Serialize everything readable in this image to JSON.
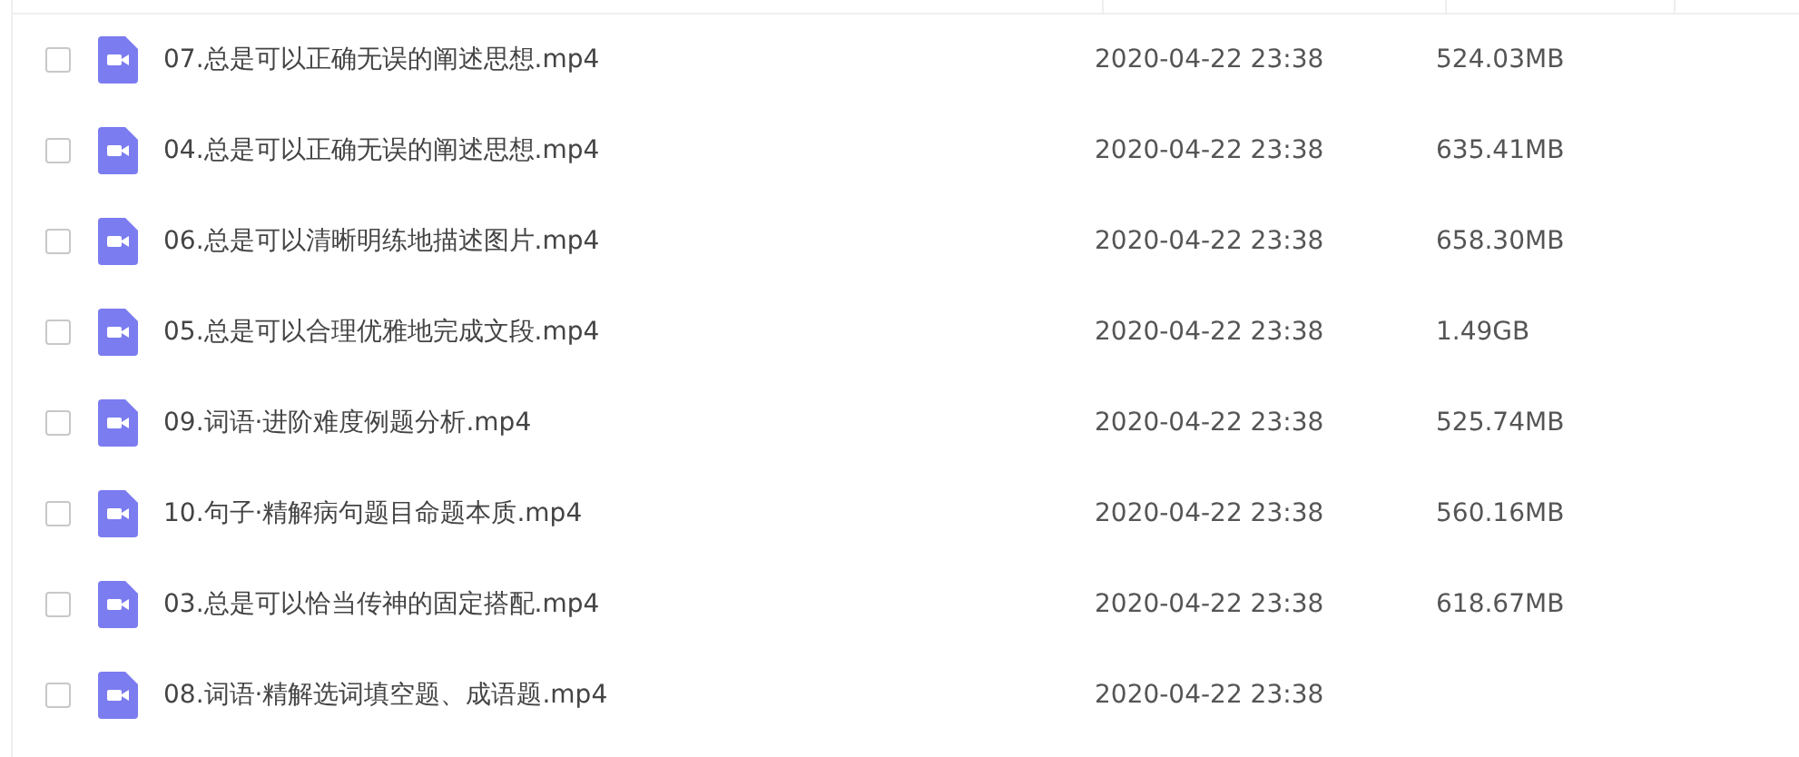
{
  "files": [
    {
      "name": "07.总是可以正确无误的阐述思想.mp4",
      "modified": "2020-04-22 23:38",
      "size": "524.03MB",
      "checked": false
    },
    {
      "name": "04.总是可以正确无误的阐述思想.mp4",
      "modified": "2020-04-22 23:38",
      "size": "635.41MB",
      "checked": false
    },
    {
      "name": "06.总是可以清晰明练地描述图片.mp4",
      "modified": "2020-04-22 23:38",
      "size": "658.30MB",
      "checked": false
    },
    {
      "name": "05.总是可以合理优雅地完成文段.mp4",
      "modified": "2020-04-22 23:38",
      "size": "1.49GB",
      "checked": false
    },
    {
      "name": "09.词语·进阶难度例题分析.mp4",
      "modified": "2020-04-22 23:38",
      "size": "525.74MB",
      "checked": false
    },
    {
      "name": "10.句子·精解病句题目命题本质.mp4",
      "modified": "2020-04-22 23:38",
      "size": "560.16MB",
      "checked": false
    },
    {
      "name": "03.总是可以恰当传神的固定搭配.mp4",
      "modified": "2020-04-22 23:38",
      "size": "618.67MB",
      "checked": false
    },
    {
      "name": "08.词语·精解选词填空题、成语题.mp4",
      "modified": "2020-04-22 23:38",
      "checked": false
    }
  ]
}
